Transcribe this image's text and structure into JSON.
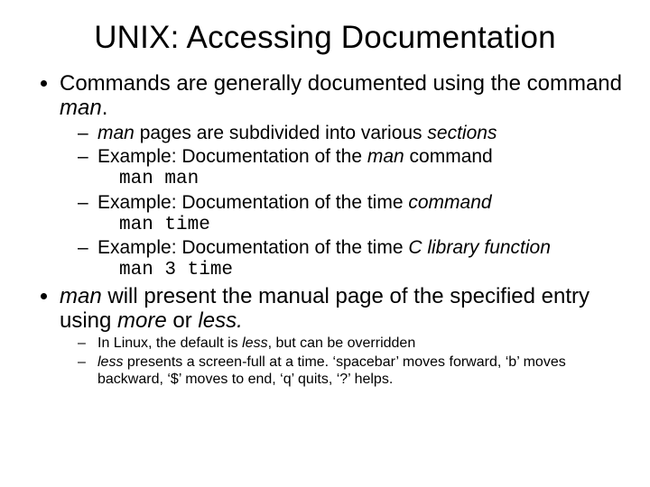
{
  "title": "UNIX: Accessing Documentation",
  "bullet1": {
    "pre": "Commands are generally documented using the command ",
    "em": "man",
    "post": "."
  },
  "sub1": {
    "a_em": "man",
    "a_mid": " pages are subdivided into various ",
    "a_em2": "sections",
    "b_pre": "Example: Documentation of the ",
    "b_em": "man",
    "b_post": " command",
    "b_code": "man man",
    "c_pre": "Example: Documentation of the time ",
    "c_em": "command",
    "c_code": "man time",
    "d_pre": "Example: Documentation of the time ",
    "d_em": "C library function",
    "d_code": "man 3 time"
  },
  "bullet2": {
    "em": "man",
    "mid": " will present the manual page of the specified entry using ",
    "em2": "more",
    "or": " or ",
    "em3": "less.",
    "sub_a_pre": "In Linux, the default is ",
    "sub_a_em": "less",
    "sub_a_post": ", but can be overridden",
    "sub_b_em": "less",
    "sub_b_post": " presents a screen-full at a time. ‘spacebar’ moves forward, ‘b’ moves backward, ‘$’ moves to end, ‘q’ quits, ‘?’ helps."
  }
}
